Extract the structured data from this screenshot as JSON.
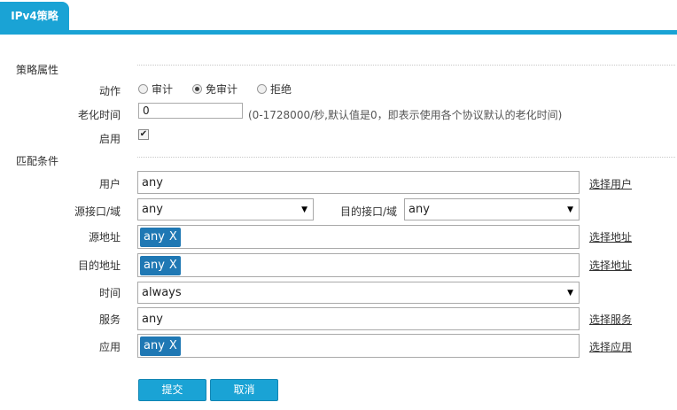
{
  "tab": {
    "label": "IPv4策略"
  },
  "policy": {
    "section_title": "策略属性",
    "action": {
      "label": "动作",
      "options": [
        {
          "label": "审计",
          "checked": false
        },
        {
          "label": "免审计",
          "checked": true
        },
        {
          "label": "拒绝",
          "checked": false
        }
      ]
    },
    "aging": {
      "label": "老化时间",
      "value": "0",
      "hint": "(0-1728000/秒,默认值是0，即表示使用各个协议默认的老化时间)"
    },
    "enable": {
      "label": "启用",
      "checked": true
    }
  },
  "match": {
    "section_title": "匹配条件",
    "user": {
      "label": "用户",
      "value": "any",
      "link": "选择用户"
    },
    "src_if": {
      "label": "源接口/域",
      "value": "any"
    },
    "dst_if": {
      "label": "目的接口/域",
      "value": "any"
    },
    "src_addr": {
      "label": "源地址",
      "chip": "any",
      "chip_x": "X",
      "link": "选择地址"
    },
    "dst_addr": {
      "label": "目的地址",
      "chip": "any",
      "chip_x": "X",
      "link": "选择地址"
    },
    "time": {
      "label": "时间",
      "value": "always"
    },
    "service": {
      "label": "服务",
      "value": "any",
      "link": "选择服务"
    },
    "app": {
      "label": "应用",
      "chip": "any",
      "chip_x": "X",
      "link": "选择应用"
    }
  },
  "buttons": {
    "submit": "提交",
    "cancel": "取消"
  }
}
